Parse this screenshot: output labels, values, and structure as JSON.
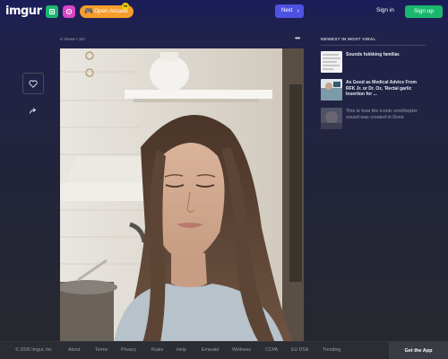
{
  "header": {
    "logo": "imgur",
    "arcade_label": "Open Arcade",
    "arcade_badge": "99",
    "next_label": "Next",
    "signin_label": "Sign in",
    "signup_label": "Sign up"
  },
  "post": {
    "meta": "4 Views • 3m",
    "icons": [
      "heart-icon",
      "share-arrow-icon",
      "more-dots-icon"
    ]
  },
  "sidebar": {
    "title": "NEWEST IN MOST VIRAL",
    "items": [
      {
        "title": "Sounds fukkking familiar."
      },
      {
        "title": "As Good as Medical Advice From RFK Jr. or Dr. Oz, 'Rectal garlic Insertion for ..."
      },
      {
        "title": "This is how the iconic ornithopter sound was created in Dune"
      }
    ]
  },
  "footer": {
    "links": [
      "© 2026 Imgur, Inc",
      "About",
      "Terms",
      "Privacy",
      "Rules",
      "Help",
      "Emerald",
      "Wellness",
      "CCPA",
      "EU DSA",
      "Trending"
    ],
    "get_app": "Get the App"
  },
  "colors": {
    "accent_green": "#1bb76e",
    "next_blue": "#4e52e0",
    "arcade_orange": "#f59e2b",
    "gift_pink": "#d946c6"
  }
}
